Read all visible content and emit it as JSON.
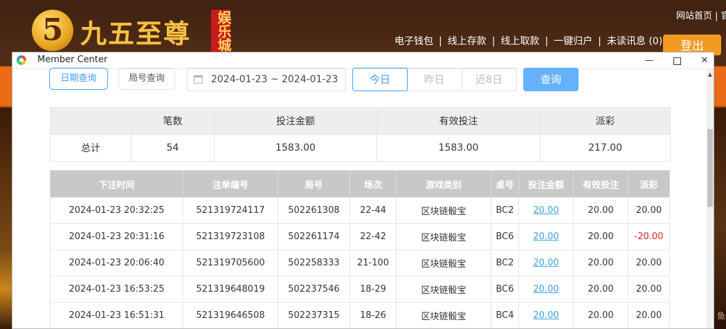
{
  "site": {
    "logo_mark": "5",
    "logo_text": "九五至尊",
    "logo_tag": "娱乐城",
    "top_links": "网站首页 | 官",
    "nav": [
      "电子钱包",
      "|",
      "线上存款",
      "|",
      "线上取款",
      "|",
      "一键归户",
      "|",
      "未读讯息 (0)"
    ],
    "logout_label": "登出",
    "side_text": "鱼"
  },
  "window": {
    "title": "Member Center",
    "min_glyph": "—",
    "close_glyph": "✕"
  },
  "filters": {
    "tab_date": "日期查询",
    "tab_round": "局号查询",
    "date_range": "2024-01-23 ~ 2024-01-23",
    "quick_today": "今日",
    "quick_yesterday": "昨日",
    "quick_last8": "近8日",
    "search_label": "查询",
    "active_color": "#409eff",
    "search_color": "#66b1ff"
  },
  "summary": {
    "headers": [
      "",
      "笔数",
      "投注金额",
      "有效投注",
      "派彩"
    ],
    "row": {
      "label": "总计",
      "count": "54",
      "bet_amount": "1583.00",
      "valid_bet": "1583.00",
      "payout": "217.00"
    }
  },
  "detail": {
    "headers": [
      "下注时间",
      "注单编号",
      "局号",
      "场次",
      "游戏类别",
      "桌号",
      "投注金额",
      "有效投注",
      "派彩"
    ],
    "rows": [
      {
        "time": "2024-01-23 20:32:25",
        "bet_no": "521319724117",
        "round": "502261308",
        "session": "22-44",
        "game": "区块链骰宝",
        "table": "BC2",
        "bet": "20.00",
        "valid": "20.00",
        "payout": "20.00"
      },
      {
        "time": "2024-01-23 20:31:16",
        "bet_no": "521319723108",
        "round": "502261174",
        "session": "22-42",
        "game": "区块链骰宝",
        "table": "BC6",
        "bet": "20.00",
        "valid": "20.00",
        "payout": "-20.00"
      },
      {
        "time": "2024-01-23 20:06:40",
        "bet_no": "521319705600",
        "round": "502258333",
        "session": "21-100",
        "game": "区块链骰宝",
        "table": "BC2",
        "bet": "20.00",
        "valid": "20.00",
        "payout": "20.00"
      },
      {
        "time": "2024-01-23 16:53:25",
        "bet_no": "521319648019",
        "round": "502237546",
        "session": "18-29",
        "game": "区块链骰宝",
        "table": "BC6",
        "bet": "20.00",
        "valid": "20.00",
        "payout": "20.00"
      },
      {
        "time": "2024-01-23 16:51:31",
        "bet_no": "521319646508",
        "round": "502237315",
        "session": "18-26",
        "game": "区块链骰宝",
        "table": "BC4",
        "bet": "20.00",
        "valid": "20.00",
        "payout": "20.00"
      }
    ],
    "negative_color": "#e02020",
    "link_color": "#3aa0e0"
  }
}
